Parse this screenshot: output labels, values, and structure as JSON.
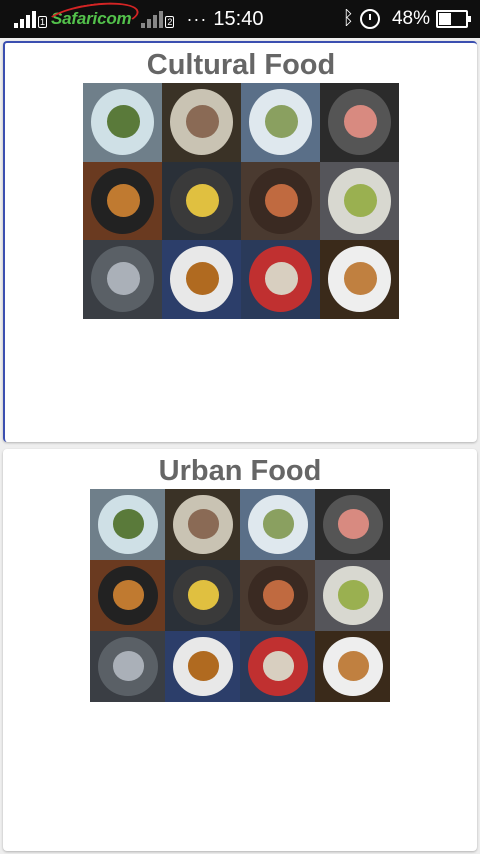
{
  "status_bar": {
    "carrier": "Safaricom",
    "sim1_badge": "1",
    "sim2_badge": "2",
    "overflow": "···",
    "time": "15:40",
    "bluetooth_icon": "bluetooth-icon",
    "alarm_icon": "alarm-icon",
    "battery_percent": "48%",
    "battery_level": 0.48
  },
  "cards": [
    {
      "title": "Cultural Food",
      "image_alt": "food-photo-grid"
    },
    {
      "title": "Urban Food",
      "image_alt": "food-photo-grid"
    }
  ],
  "tile_palette": [
    {
      "bg": "#6f7f8a",
      "plate": "#cfe0e6",
      "food": "#5a7a3a"
    },
    {
      "bg": "#3a3226",
      "plate": "#c9c3b3",
      "food": "#8a6a55"
    },
    {
      "bg": "#5a6f88",
      "plate": "#dfe8ee",
      "food": "#8aa060"
    },
    {
      "bg": "#2b2b2b",
      "plate": "#555555",
      "food": "#d88a80"
    },
    {
      "bg": "#6a3a20",
      "plate": "#222222",
      "food": "#c07a30"
    },
    {
      "bg": "#2a3038",
      "plate": "#3a3a3a",
      "food": "#e0c040"
    },
    {
      "bg": "#4a3a30",
      "plate": "#3a2a22",
      "food": "#c06a40"
    },
    {
      "bg": "#55555a",
      "plate": "#d8d8d0",
      "food": "#9ab050"
    },
    {
      "bg": "#3a3e44",
      "plate": "#5a6066",
      "food": "#aab0b8"
    },
    {
      "bg": "#2c3e6a",
      "plate": "#e8e8e8",
      "food": "#b06a20"
    },
    {
      "bg": "#2a3a5a",
      "plate": "#c03030",
      "food": "#d8cfc0"
    },
    {
      "bg": "#3a2a1a",
      "plate": "#eeeeee",
      "food": "#c08040"
    }
  ]
}
